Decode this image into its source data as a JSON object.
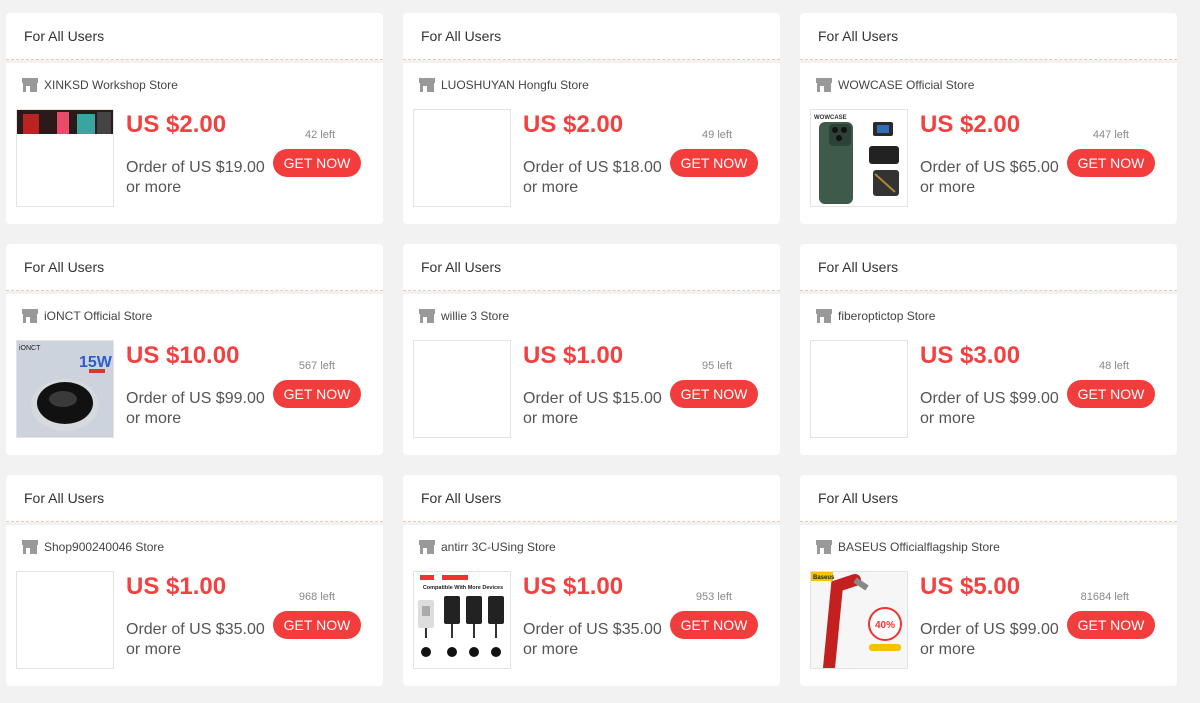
{
  "coupons": [
    {
      "header": "For All Users",
      "store": "XINKSD Workshop Store",
      "price": "US $2.00",
      "order": "Order of US $19.00 or more",
      "left": "42 left",
      "button": "GET NOW",
      "thumb": "xinksd-product-image"
    },
    {
      "header": "For All Users",
      "store": "LUOSHUYAN Hongfu Store",
      "price": "US $2.00",
      "order": "Order of US $18.00 or more",
      "left": "49 left",
      "button": "GET NOW",
      "thumb": "blank-image"
    },
    {
      "header": "For All Users",
      "store": "WOWCASE Official Store",
      "price": "US $2.00",
      "order": "Order of US $65.00 or more",
      "left": "447 left",
      "button": "GET NOW",
      "thumb": "wowcase-phone-case-image",
      "thumb_text": "WOWCASE"
    },
    {
      "header": "For All Users",
      "store": "iONCT Official Store",
      "price": "US $10.00",
      "order": "Order of US $99.00 or more",
      "left": "567 left",
      "button": "GET NOW",
      "thumb": "wireless-charger-image",
      "thumb_text": "15W",
      "thumb_brand": "iONCT"
    },
    {
      "header": "For All Users",
      "store": "willie 3 Store",
      "price": "US $1.00",
      "order": "Order of US $15.00 or more",
      "left": "95 left",
      "button": "GET NOW",
      "thumb": "blank-image"
    },
    {
      "header": "For All Users",
      "store": "fiberoptictop Store",
      "price": "US $3.00",
      "order": "Order of US $99.00 or more",
      "left": "48 left",
      "button": "GET NOW",
      "thumb": "blank-image"
    },
    {
      "header": "For All Users",
      "store": "Shop900240046 Store",
      "price": "US $1.00",
      "order": "Order of US $35.00 or more",
      "left": "968 left",
      "button": "GET NOW",
      "thumb": "blank-image"
    },
    {
      "header": "For All Users",
      "store": "antirr 3C-USing Store",
      "price": "US $1.00",
      "order": "Order of US $35.00 or more",
      "left": "953 left",
      "button": "GET NOW",
      "thumb": "wireless-receiver-image",
      "thumb_text": "Compatible With More Devices"
    },
    {
      "header": "For All Users",
      "store": "BASEUS Officialflagship Store",
      "price": "US $5.00",
      "order": "Order of US $99.00 or more",
      "left": "81684 left",
      "button": "GET NOW",
      "thumb": "baseus-cable-image",
      "thumb_text": "40%",
      "thumb_brand": "Baseus"
    }
  ],
  "colors": {
    "accent": "#f33d3d",
    "price": "#f44040",
    "background": "#f2f2f2",
    "card": "#ffffff",
    "divider": "#f3c8a8"
  }
}
